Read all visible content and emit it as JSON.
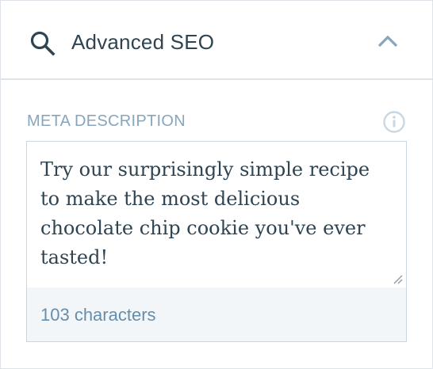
{
  "header": {
    "icon": "search-icon",
    "title": "Advanced SEO",
    "toggle_icon": "chevron-up-icon"
  },
  "meta_description": {
    "label": "META DESCRIPTION",
    "info_icon": "info-icon",
    "value": "Try our surprisingly simple recipe to make the most delicious chocolate chip cookie you've ever tasted!",
    "character_count": "103 characters"
  },
  "colors": {
    "heading_text": "#2e4453",
    "label_text": "#87a6bc",
    "counter_text": "#668eaa",
    "border": "#dde3e8",
    "counter_background": "#f3f6f8"
  }
}
